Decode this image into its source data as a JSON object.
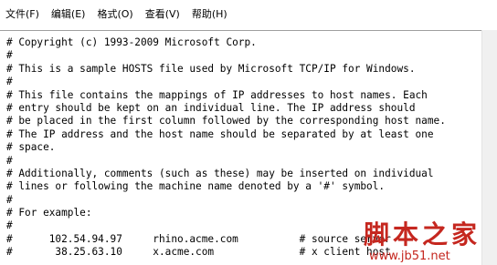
{
  "menubar": {
    "items": [
      "文件(F)",
      "编辑(E)",
      "格式(O)",
      "查看(V)",
      "帮助(H)"
    ]
  },
  "editor": {
    "lines": [
      "# Copyright (c) 1993-2009 Microsoft Corp.",
      "#",
      "# This is a sample HOSTS file used by Microsoft TCP/IP for Windows.",
      "#",
      "# This file contains the mappings of IP addresses to host names. Each",
      "# entry should be kept on an individual line. The IP address should",
      "# be placed in the first column followed by the corresponding host name.",
      "# The IP address and the host name should be separated by at least one",
      "# space.",
      "#",
      "# Additionally, comments (such as these) may be inserted on individual",
      "# lines or following the machine name denoted by a '#' symbol.",
      "#",
      "# For example:",
      "#",
      "#      102.54.94.97     rhino.acme.com          # source server",
      "#       38.25.63.10     x.acme.com              # x client host"
    ]
  },
  "watermark": {
    "title": "脚本之家",
    "url": "www.jb51.net"
  },
  "colors": {
    "watermark": "#c5271f",
    "separator": "#9f9f9f"
  }
}
